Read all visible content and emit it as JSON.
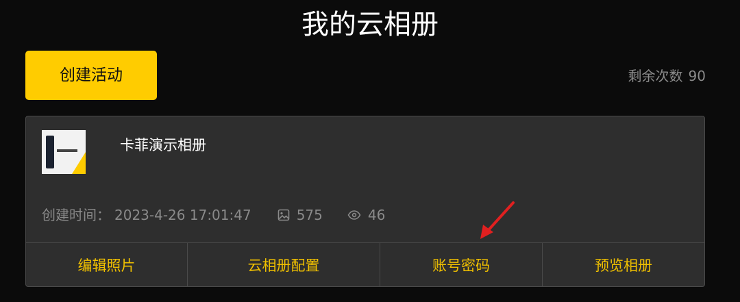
{
  "page": {
    "title": "我的云相册"
  },
  "toolbar": {
    "create_label": "创建活动",
    "remaining_label": "剩余次数",
    "remaining_count": "90"
  },
  "album": {
    "name": "卡菲演示相册",
    "created_label": "创建时间：",
    "created_time": "2023-4-26 17:01:47",
    "photos_count": "575",
    "views_count": "46",
    "actions": [
      {
        "label": "编辑照片"
      },
      {
        "label": "云相册配置"
      },
      {
        "label": "账号密码"
      },
      {
        "label": "预览相册"
      }
    ]
  },
  "colors": {
    "accent": "#ffcc00",
    "action_text": "#f0c000",
    "card_bg": "#2e2e2e",
    "page_bg": "#0b0b0b",
    "annotation_arrow": "#e02020"
  },
  "icons": {
    "photos": "image-icon",
    "views": "eye-icon"
  }
}
